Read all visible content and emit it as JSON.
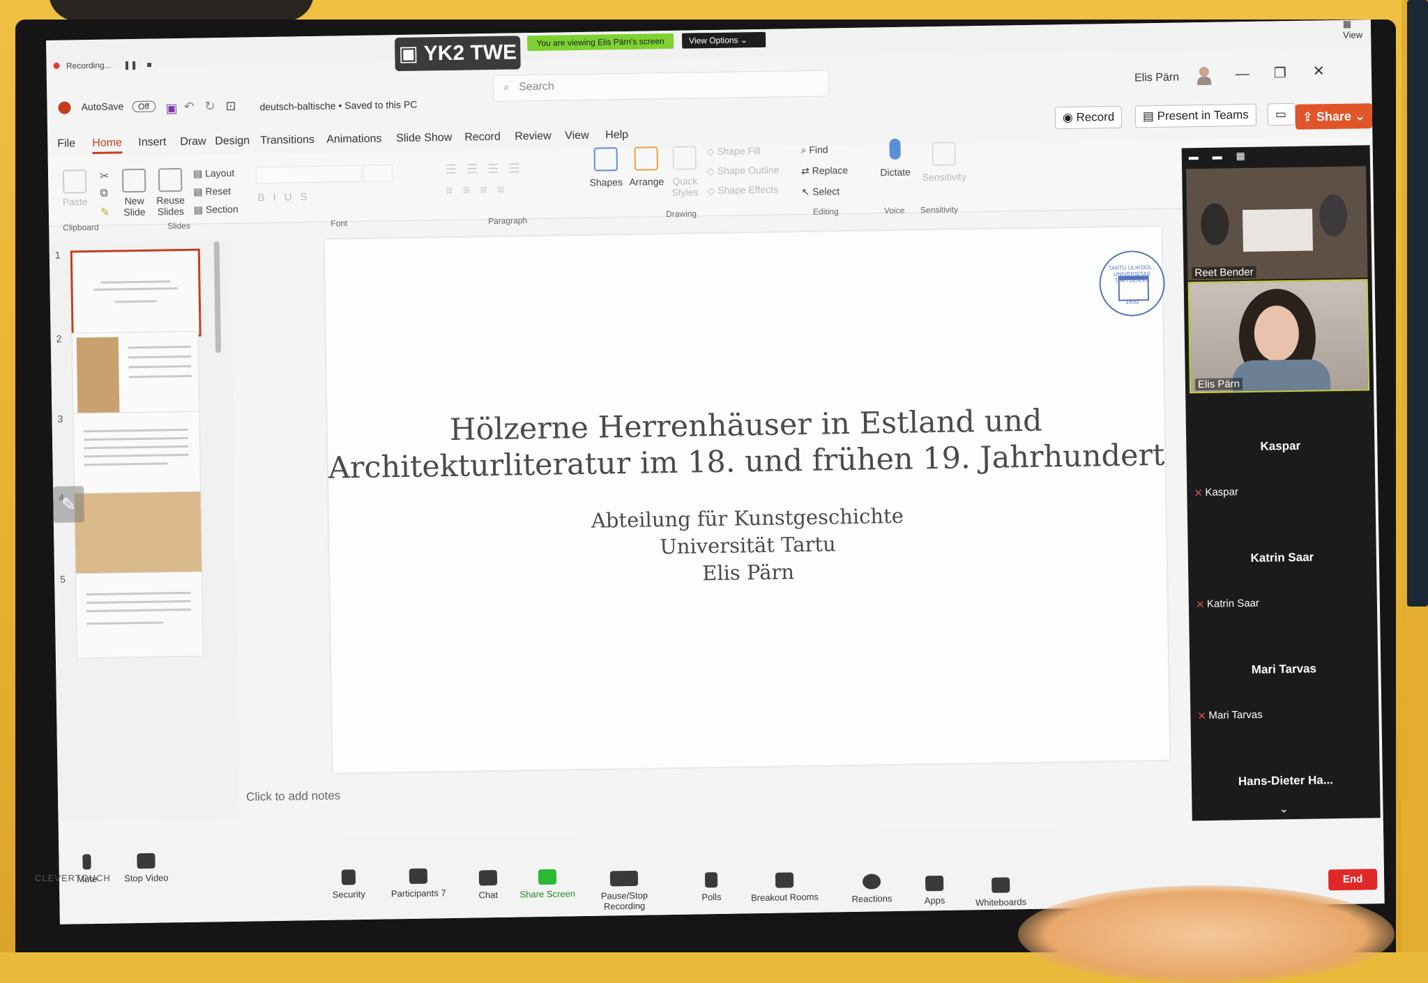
{
  "zoom_top": {
    "recording_label": "Recording...",
    "viewing_text": "You are viewing Elis Pärn's screen",
    "view_options": "View Options",
    "room_name": "YK2 TWE",
    "view_label": "View"
  },
  "ppt_titlebar": {
    "autosave": "AutoSave",
    "autosave_state": "Off",
    "file_name": "deutsch-baltische • Saved to this PC",
    "search_placeholder": "Search",
    "user_name": "Elis Pärn",
    "record_btn": "Record",
    "present_btn": "Present in Teams",
    "share_btn": "Share"
  },
  "menu_tabs": [
    "File",
    "Home",
    "Insert",
    "Draw",
    "Design",
    "Transitions",
    "Animations",
    "Slide Show",
    "Record",
    "Review",
    "View",
    "Help"
  ],
  "ribbon": {
    "clipboard": {
      "paste": "Paste",
      "label": "Clipboard"
    },
    "slides": {
      "new_slide": "New Slide",
      "reuse_slides": "Reuse Slides",
      "layout": "Layout",
      "reset": "Reset",
      "section": "Section",
      "label": "Slides"
    },
    "font": {
      "label": "Font"
    },
    "paragraph": {
      "label": "Paragraph"
    },
    "drawing": {
      "shapes": "Shapes",
      "arrange": "Arrange",
      "quick_styles": "Quick Styles",
      "shape_fill": "Shape Fill",
      "shape_outline": "Shape Outline",
      "shape_effects": "Shape Effects",
      "label": "Drawing"
    },
    "editing": {
      "find": "Find",
      "replace": "Replace",
      "select": "Select",
      "label": "Editing"
    },
    "voice": {
      "dictate": "Dictate",
      "label": "Voice"
    },
    "sensitivity": {
      "btn": "Sensitivity",
      "label": "Sensitivity"
    }
  },
  "thumbnails": [
    "1",
    "2",
    "3",
    "4",
    "5"
  ],
  "slide": {
    "title_line1": "Hölzerne Herrenhäuser in Estland und",
    "title_line2": "Architekturliteratur im 18. und frühen 19. Jahrhundert",
    "sub_line1": "Abteilung für Kunstgeschichte",
    "sub_line2": "Universität Tartu",
    "sub_line3": "Elis Pärn",
    "seal_text": "TARTU ÜLIKOOL · UNIVERSITAS TARTUENSIS",
    "seal_year": "1632"
  },
  "notes_placeholder": "Click to add notes",
  "participants": {
    "video1": "Reet Bender",
    "video2": "Elis Pärn",
    "tiles": [
      {
        "name": "Kaspar",
        "sub": "Kaspar"
      },
      {
        "name": "Katrin Saar",
        "sub": "Katrin Saar"
      },
      {
        "name": "Mari Tarvas",
        "sub": "Mari Tarvas"
      },
      {
        "name": "Hans-Dieter  Ha...",
        "sub": ""
      }
    ]
  },
  "zoom_toolbar": {
    "mute": "Mute",
    "stop_video": "Stop Video",
    "security": "Security",
    "participants": "Participants",
    "participants_count": "7",
    "chat": "Chat",
    "share_screen": "Share Screen",
    "pause_recording": "Pause/Stop Recording",
    "polls": "Polls",
    "breakout": "Breakout Rooms",
    "reactions": "Reactions",
    "apps": "Apps",
    "whiteboards": "Whiteboards",
    "end": "End"
  },
  "monitor_brand": "CLEVERTOUCH"
}
